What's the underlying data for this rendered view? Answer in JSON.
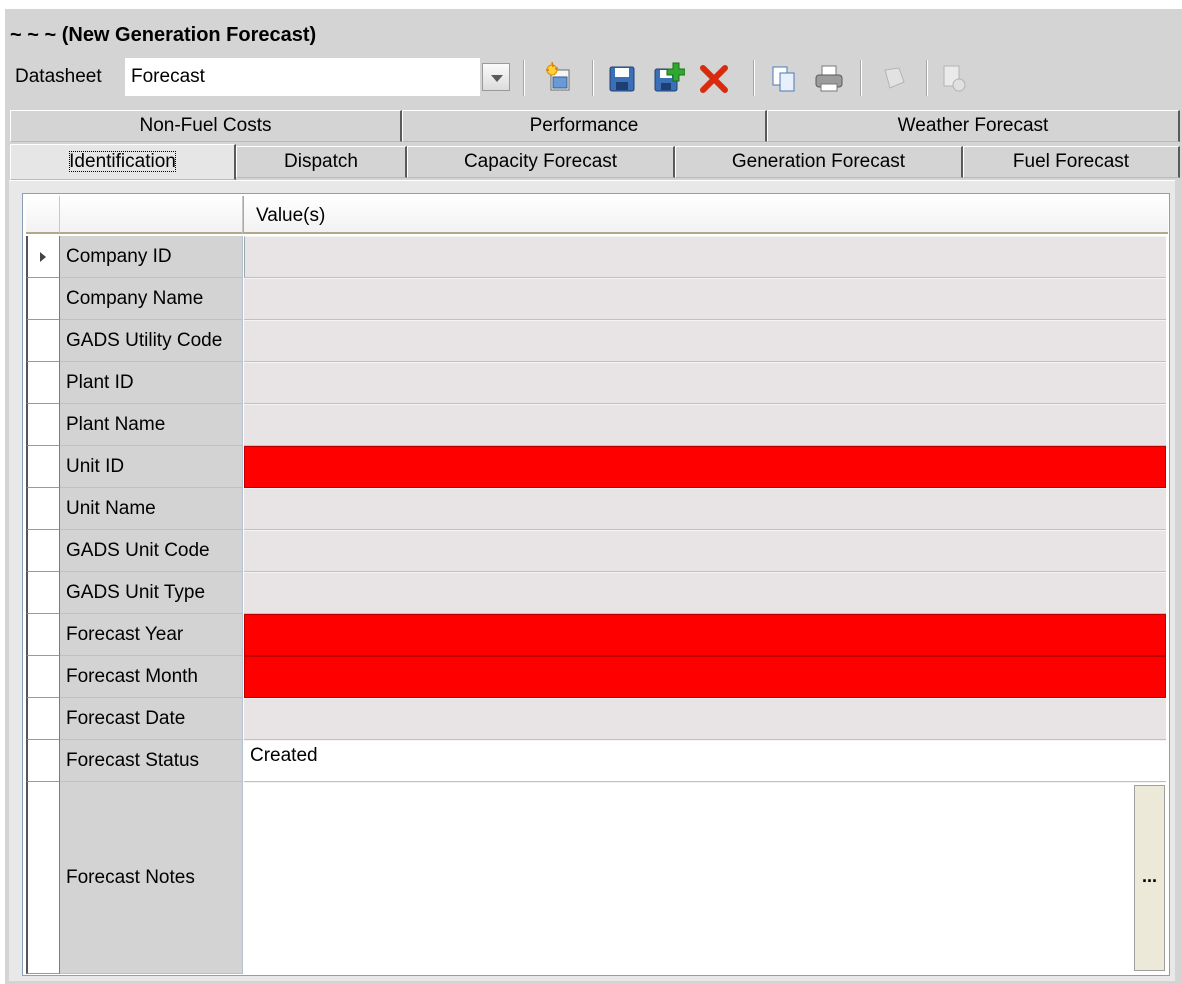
{
  "window": {
    "title": "~ ~ ~ (New Generation Forecast)"
  },
  "toolbar": {
    "datasheet_label": "Datasheet",
    "datasheet_value": "Forecast",
    "icons": [
      "new-record-icon",
      "save-icon",
      "save-and-add-icon",
      "delete-icon",
      "copy-icon",
      "print-icon",
      "disabled-icon",
      "disabled-report-icon"
    ]
  },
  "tabs": {
    "row1": [
      {
        "label": "Non-Fuel Costs"
      },
      {
        "label": "Performance"
      },
      {
        "label": "Weather Forecast"
      }
    ],
    "row2": [
      {
        "label": "Identification",
        "active": true
      },
      {
        "label": "Dispatch"
      },
      {
        "label": "Capacity Forecast"
      },
      {
        "label": "Generation Forecast"
      },
      {
        "label": "Fuel Forecast"
      }
    ]
  },
  "grid": {
    "column_header": "Value(s)",
    "rows": [
      {
        "field": "Company ID",
        "value": "",
        "state": "normal"
      },
      {
        "field": "Company Name",
        "value": "",
        "state": "normal"
      },
      {
        "field": "GADS Utility Code",
        "value": "",
        "state": "normal"
      },
      {
        "field": "Plant ID",
        "value": "",
        "state": "normal"
      },
      {
        "field": "Plant Name",
        "value": "",
        "state": "normal"
      },
      {
        "field": "Unit ID",
        "value": "",
        "state": "required"
      },
      {
        "field": "Unit Name",
        "value": "",
        "state": "normal"
      },
      {
        "field": "GADS Unit Code",
        "value": "",
        "state": "normal"
      },
      {
        "field": "GADS Unit Type",
        "value": "",
        "state": "normal"
      },
      {
        "field": "Forecast Year",
        "value": "",
        "state": "required"
      },
      {
        "field": "Forecast Month",
        "value": "",
        "state": "required"
      },
      {
        "field": "Forecast Date",
        "value": "",
        "state": "normal"
      },
      {
        "field": "Forecast Status",
        "value": "Created",
        "state": "editable"
      },
      {
        "field": "Forecast Notes",
        "value": "",
        "state": "editable",
        "ellipsis_label": "..."
      }
    ]
  },
  "colors": {
    "required": "#ff0000",
    "readonly": "#e8e4e6",
    "field_label_bg": "#d3d3d3",
    "icon_save": "#3b6fb6",
    "icon_add": "#2fa82f",
    "icon_delete": "#d82a0c"
  }
}
